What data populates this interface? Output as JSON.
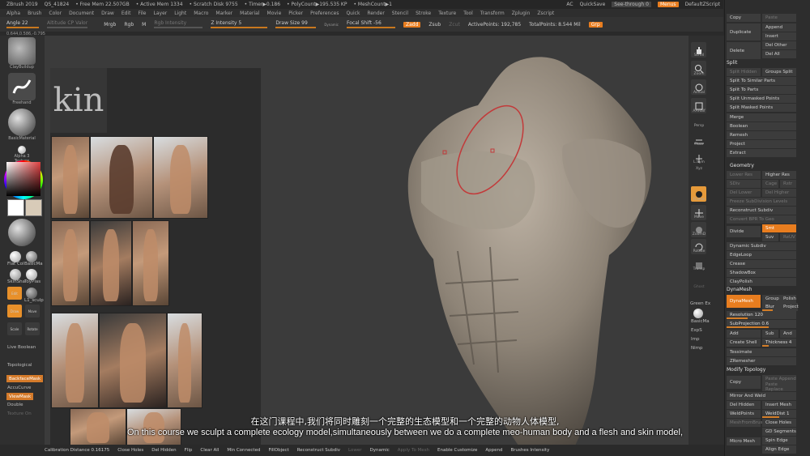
{
  "titlebar": {
    "items": [
      "ZBrush 2019",
      "QS_41824",
      "• Free Mem 22.507GB",
      "• Active Mem 1334",
      "• Scratch Disk 9755",
      "• Timer▶0.186",
      "• PolyCount▶195.535 KP",
      "• MeshCount▶1"
    ],
    "ac": "AC",
    "quicksave": "QuickSave",
    "seethrough": "See-through",
    "seethrough_val": "0",
    "menus": "Menus",
    "script": "DefaultZScript"
  },
  "menubar": [
    "Alpha",
    "Brush",
    "Color",
    "Document",
    "Draw",
    "Edit",
    "File",
    "Layer",
    "Light",
    "Macro",
    "Marker",
    "Material",
    "Movie",
    "Picker",
    "Preferences",
    "Quick",
    "Render",
    "Stencil",
    "Stroke",
    "Texture",
    "Tool",
    "Transform",
    "Zplugin",
    "Zscript"
  ],
  "toolbar": {
    "angle": "Angle 22",
    "altitude": "Altitude CP Valor",
    "mrgb": "Mrgb",
    "rgb": "Rgb",
    "m": "M",
    "rgb_intensity": "Rgb Intensity",
    "z_intensity": "Z Intensity 5",
    "draw_size": "Draw Size 99",
    "dynamic": "Dynamic",
    "focal_shift": "Focal Shift -56",
    "zadd": "Zadd",
    "zsub": "Zsub",
    "zcut": "Zcut",
    "active_points": "ActivePoints: 192,785",
    "total_points": "TotalPoints: 8.544 Mil",
    "grp": "Grp"
  },
  "coords": "0.644,0.586,-0.795",
  "left_shelf": {
    "clay_buildup": "ClayBuildup",
    "freehand": "Freehand",
    "basic_material": "BasicMaterial",
    "alpha_texture": "Alpha 3 Texture",
    "flat_col": "Flat Col",
    "basic_m": "BasicMa",
    "skin_shade": "SkinSha",
    "toy_plastic": "ToyPlas",
    "edit": "Edit",
    "l1_sculpt": "L1_sculp",
    "draw": "Draw",
    "move": "Move",
    "scale": "Scale",
    "rotate": "Rotate",
    "live_boolean": "Live Boolean",
    "topological": "Topological",
    "backface_mask": "BackfaceMask",
    "accucurve": "AccuCurve",
    "viewmask": "ViewMask",
    "double": "Double",
    "texture_on": "Texture On"
  },
  "refpanel": {
    "header": "kin"
  },
  "right_shelf": [
    "Scroll",
    "Zoom",
    "Actual",
    "AAHalf",
    "Persp",
    "Floor",
    "L.Sym",
    "Xyz",
    "Frame",
    "Move",
    "ZoomD",
    "Rotate",
    "Transp",
    "Ghost",
    "Green Ex",
    "BasicMa",
    "ExpS",
    "Imp",
    "Nimp"
  ],
  "palette": {
    "copy": "Copy",
    "paste": "Paste",
    "append": "Append",
    "duplicate": "Duplicate",
    "insert": "Insert",
    "delete": "Delete",
    "del_other": "Del Other",
    "del_all": "Del All",
    "split_head": "Split",
    "split_hidden": "Split Hidden",
    "groups_split": "Groups Split",
    "split_similar": "Split To Similar Parts",
    "split_parts": "Split To Parts",
    "split_unmasked": "Split Unmasked Points",
    "split_masked": "Split Masked Points",
    "merge": "Merge",
    "boolean": "Boolean",
    "remesh": "Remesh",
    "project": "Project",
    "extract": "Extract",
    "geometry_head": "Geometry",
    "lower_res": "Lower Res",
    "higher_res": "Higher Res",
    "sdiv": "SDiv",
    "cage": "Cage",
    "rstr": "Rstr",
    "del_lower": "Del Lower",
    "del_higher": "Del Higher",
    "freeze_subdiv": "Freeze SubDivision Levels",
    "reconstruct_subdiv": "Reconstruct Subdiv",
    "convert_bpr": "Convert BPR To Geo",
    "divide": "Divide",
    "smt": "Smt",
    "suv": "Suv",
    "reuv": "ReUV",
    "dynamic_subdiv": "Dynamic Subdiv",
    "edgeloop": "EdgeLoop",
    "crease": "Crease",
    "shadowbox": "ShadowBox",
    "claypolish": "ClayPolish",
    "dynamesh_head": "DynaMesh",
    "dynamesh": "DynaMesh",
    "group": "Group",
    "polish": "Polish",
    "blur": "Blur",
    "project2": "Project",
    "resolution": "Resolution 120",
    "subprojection": "SubProjection 0.6",
    "add": "Add",
    "sub": "Sub",
    "and": "And",
    "create_shell": "Create Shell",
    "thickness": "Thickness 4",
    "zremesher_head": "ZRemesher",
    "tessimate": "Tessimate",
    "modify_topology": "Modify Topology",
    "copy2": "Copy",
    "paste_append": "Paste Append",
    "paste_replace": "Paste Replace",
    "mirror_weld": "Mirror And Weld",
    "del_hidden": "Del Hidden",
    "insert_mesh": "Insert Mesh",
    "weldpoints": "WeldPoints",
    "welddist": "WeldDist 1",
    "meshfrombrush": "MeshFromBrush",
    "close_holes": "Close Holes",
    "gd_segments": "GD Segments",
    "micro_mesh": "Micro Mesh",
    "spin_edge": "Spin Edge",
    "align_edge": "Align Edge"
  },
  "bottombar": {
    "calibration": "Calibration Distance 0.16175",
    "close_holes": "Close Holes",
    "del_hidden": "Del Hidden",
    "flip": "Flip",
    "clear_all": "Clear All",
    "min_connected": "Min Connected",
    "fillobject": "FillObject",
    "reconstruct": "Reconstruct Subdiv",
    "lower": "Lower",
    "dynamic": "Dynamic",
    "apply_to_mesh": "Apply To Mesh",
    "enable_customize": "Enable Customize",
    "append": "Append",
    "brushes_intensity": "Brushes Intensity"
  },
  "subtitles": {
    "cn": "在这门课程中,我们将同时雕刻一个完整的生态模型和一个完整的动物人体模型,",
    "en": "On this course we sculpt a complete ecology model,simultaneously between we do a complete meo-human body and a flesh and skin model,"
  }
}
